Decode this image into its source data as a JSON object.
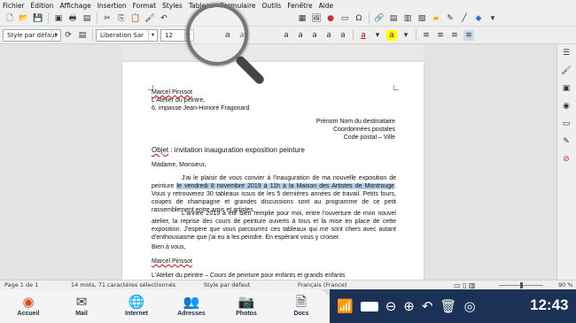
{
  "menu": [
    "Fichier",
    "Édition",
    "Affichage",
    "Insertion",
    "Format",
    "Styles",
    "Tableau",
    "Formulaire",
    "Outils",
    "Fenêtre",
    "Aide"
  ],
  "toolbar": {
    "paragraph_style": "Style par défaut",
    "font_name": "Liberation Sar",
    "font_size": "12"
  },
  "document": {
    "sender_name": "Marcel Pinssot",
    "sender_company": "L'Atelier du peintre,",
    "sender_address": "6, impasse Jean-Honoré Fragonard",
    "recipient_name": "Prénom Nom du destinataire",
    "recipient_coords": "Coordonnées postales",
    "recipient_city": "Code postal – Ville",
    "subject_label": "Objet",
    "subject_text": " : invitation inauguration exposition peinture",
    "greeting": "Madame, Monsieur,",
    "p1_start": "J'ai le plaisir de vous convier à l'inauguration de ma nouvelle exposition de peinture",
    "p1_selected": "le vendredi 8 novembre 2019 à 11h à la Maison des Artistes de Montrouge",
    "p1_rest": ". Vous y retrouverez 30 tableaux issus de les 5 dernières années de travail. Petits fours, coupes de champagne et grandes discussions sont au programme de ce petit rassemblement entre amis et artistes.",
    "p2": "L'année 2019 a été bien remplie pour moi, entre l'ouverture de mon nouvel atelier, la reprise des cours de peinture ouverts à tous et la mise en place de cette exposition. J'espère que vous parcourrez ces tableaux qui me sont chers avec autant d'enthousiasme que j'ai eu à les peindre. En espérant vous y croiser.",
    "closing": "Bien à vous,",
    "signature": "Marcel Pinssot",
    "footer": "L'Atelier du peintre – Cours de peinture pour enfants et grands enfants"
  },
  "status": {
    "page": "Page 1 de 1",
    "words": "14 mots, 71 caractères sélectionnés",
    "style": "Style par défaut",
    "language": "Français (France)",
    "zoom": "90 %"
  },
  "taskbar": {
    "apps": [
      "Accueil",
      "Mail",
      "Internet",
      "Adresses",
      "Photos",
      "Docs"
    ],
    "clock": "12:43"
  }
}
